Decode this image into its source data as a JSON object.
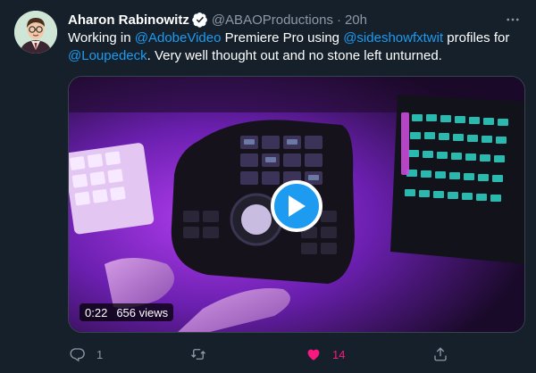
{
  "tweet": {
    "author": {
      "display_name": "Aharon Rabinowitz",
      "verified": true,
      "verified_icon": "verified-badge-icon",
      "handle": "@ABAOProductions",
      "separator": "·",
      "time": "20h"
    },
    "text": {
      "p1": "Working in ",
      "m1": "@AdobeVideo",
      "p2": " Premiere Pro using ",
      "m2": "@sideshowfxtwit",
      "p3": " profiles for ",
      "m3": "@Loupedeck",
      "p4": ". Very well thought out and no stone left unturned."
    },
    "media": {
      "type": "video",
      "duration": "0:22",
      "views": "656 views",
      "play_icon": "play-icon"
    },
    "actions": {
      "reply_count": "1",
      "retweet_count": "",
      "like_count": "14",
      "liked": true
    }
  },
  "colors": {
    "background": "#15202b",
    "accent": "#1d9bf0",
    "like": "#f91880",
    "muted_text": "#8b98a5"
  }
}
